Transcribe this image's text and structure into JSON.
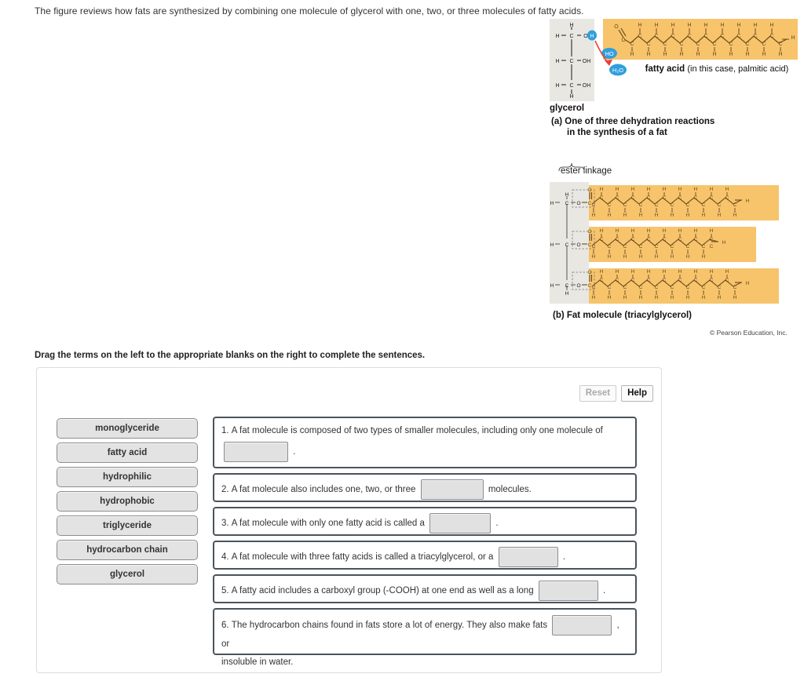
{
  "intro": {
    "text": "The figure reviews how fats are synthesized by combining one molecule of glycerol with one, two, or three molecules of fatty acids."
  },
  "figure": {
    "panel_a": {
      "glycerol_label": "glycerol",
      "fatty_acid_label": "fatty acid",
      "fatty_acid_sublabel": "(in this case, palmitic acid)",
      "water_bubble": "H2O",
      "hydroxyl_bubble": "HO",
      "caption_line1": "(a) One of three dehydration reactions",
      "caption_line2": "in the synthesis of a fat",
      "atoms": {
        "h": "H",
        "c": "C",
        "o": "O",
        "oh": "OH"
      }
    },
    "panel_b": {
      "ester_label": "ester linkage",
      "caption": "(b) Fat molecule (triacylglycerol)",
      "atoms": {
        "h": "H",
        "c": "C",
        "o": "O"
      }
    },
    "copyright": "© Pearson Education, Inc.",
    "colors": {
      "fatty_acid_panel": "#f7c46c",
      "glycerol_panel": "#e8e7e2",
      "bubble_blue": "#2f9fdc",
      "arrow_red": "#e8413a",
      "bond_brown": "#6b4a1d"
    }
  },
  "drag_instruction": "Drag the terms on the left to the appropriate blanks on the right to complete the sentences.",
  "toolbar": {
    "reset_label": "Reset",
    "help_label": "Help"
  },
  "terms": [
    {
      "label": "monoglyceride"
    },
    {
      "label": "fatty acid"
    },
    {
      "label": "hydrophilic"
    },
    {
      "label": "hydrophobic"
    },
    {
      "label": "triglyceride"
    },
    {
      "label": "hydrocarbon chain"
    },
    {
      "label": "glycerol"
    }
  ],
  "sentences": [
    {
      "number": "1.",
      "part1": "A fat molecule is composed of two types of smaller molecules, including only one molecule of",
      "blank_value": "",
      "part2": "."
    },
    {
      "number": "2.",
      "part1": "A fat molecule also includes one, two, or three",
      "blank_value": "",
      "part2": "molecules."
    },
    {
      "number": "3.",
      "part1": "A fat molecule with only one fatty acid is called a",
      "blank_value": "",
      "part2": "."
    },
    {
      "number": "4.",
      "part1": "A fat molecule with three fatty acids is called a triacylglycerol, or a",
      "blank_value": "",
      "part2": "."
    },
    {
      "number": "5.",
      "part1": "A fatty acid includes a carboxyl group (-COOH) at one end as well as a long",
      "blank_value": "",
      "part2": "."
    },
    {
      "number": "6.",
      "part1": "The hydrocarbon chains found in fats store a lot of energy. They also make fats",
      "blank_value": "",
      "part2": ", or",
      "part3": "insoluble in water."
    }
  ]
}
